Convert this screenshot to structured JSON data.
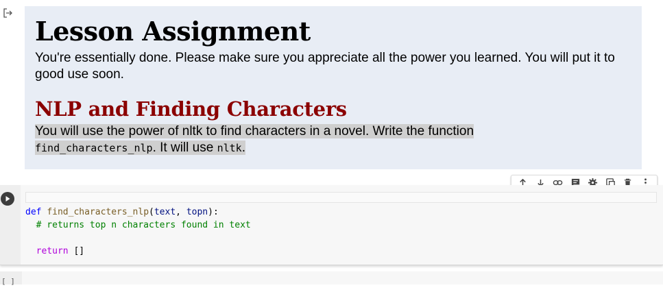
{
  "markdown": {
    "title": "Lesson Assignment",
    "intro": "You're essentially done. Please make sure you appreciate all the power you learned. You will put it to good use soon.",
    "subtitle": "NLP and Finding Characters",
    "task_prefix": "You will use the power of nltk to find characters in a novel. Write the function",
    "task_code_fn": "find_characters_nlp",
    "task_middle": ". It will use ",
    "task_code_lib": "nltk",
    "task_suffix": "."
  },
  "toolbar": {
    "icons": [
      "arrow-up-icon",
      "arrow-down-icon",
      "link-icon",
      "comment-icon",
      "gear-icon",
      "mirror-cell-icon",
      "delete-icon",
      "more-icon"
    ]
  },
  "code_cell": {
    "line1_def": "def",
    "line1_name": "find_characters_nlp",
    "line1_open": "(",
    "line1_arg1": "text",
    "line1_sep": ", ",
    "line1_arg2": "topn",
    "line1_close": "):",
    "line2_comment": "  # returns top n characters found in text",
    "line4_return": "return",
    "line4_value": " []"
  },
  "next_cell": {
    "gutter_text": "[ ]"
  },
  "colors": {
    "markdown_bg": "#e8edf5",
    "subtitle": "#8b0000",
    "keyword": "#0000ff",
    "comment": "#008000"
  }
}
